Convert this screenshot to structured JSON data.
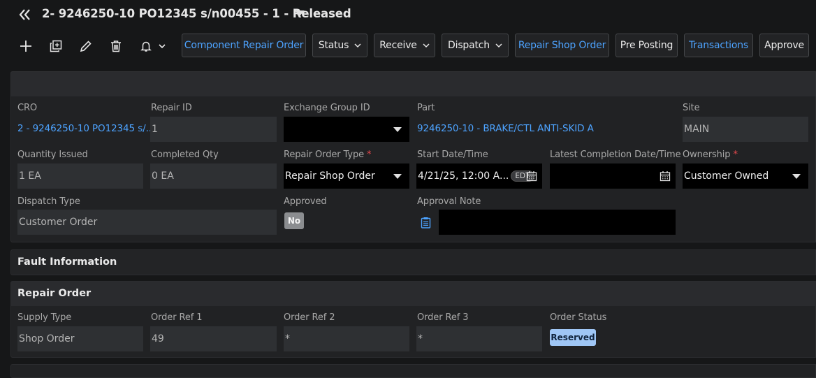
{
  "header": {
    "title": "2- 9246250-10 PO12345 s/n00455 - 1 - Released"
  },
  "toolbar": {
    "icons": [
      "add-icon",
      "duplicate-icon",
      "edit-icon",
      "delete-icon",
      "bell-icon"
    ],
    "buttons": {
      "component_repair_order": "Component Repair Order",
      "status": "Status",
      "receive": "Receive",
      "dispatch": "Dispatch",
      "repair_shop_order": "Repair Shop Order",
      "pre_posting": "Pre Posting",
      "transactions": "Transactions",
      "approve": "Approve"
    }
  },
  "header_panel": {
    "cro_label": "CRO",
    "cro_value": "2 - 9246250-10 PO12345 s/...",
    "repair_id_label": "Repair ID",
    "repair_id_value": "1",
    "exchange_group_id_label": "Exchange Group ID",
    "exchange_group_id_value": "",
    "part_label": "Part",
    "part_value": "9246250-10 - BRAKE/CTL ANTI-SKID A",
    "site_label": "Site",
    "site_value": "MAIN",
    "quantity_issued_label": "Quantity Issued",
    "quantity_issued_value": "1 EA",
    "completed_qty_label": "Completed Qty",
    "completed_qty_value": "0 EA",
    "repair_order_type_label": "Repair Order Type",
    "repair_order_type_value": "Repair Shop Order",
    "start_datetime_label": "Start Date/Time",
    "start_datetime_value": "4/21/25, 12:00 A...",
    "start_tz": "EDT",
    "latest_completion_label": "Latest Completion Date/Time",
    "latest_completion_value": "",
    "ownership_label": "Ownership",
    "ownership_value": "Customer Owned",
    "required_marker": "*",
    "dispatch_type_label": "Dispatch Type",
    "dispatch_type_value": "Customer Order",
    "approved_label": "Approved",
    "approved_value": "No",
    "approval_note_label": "Approval Note",
    "approval_note_value": ""
  },
  "fault_section": {
    "title": "Fault Information"
  },
  "repair_order_section": {
    "title": "Repair Order",
    "supply_type_label": "Supply Type",
    "supply_type_value": "Shop Order",
    "order_ref1_label": "Order Ref 1",
    "order_ref1_value": "49",
    "order_ref2_label": "Order Ref 2",
    "order_ref2_value": "*",
    "order_ref3_label": "Order Ref 3",
    "order_ref3_value": "*",
    "order_status_label": "Order Status",
    "order_status_value": "Reserved"
  },
  "colors": {
    "background": "#161718",
    "panel": "#212224",
    "link": "#4da3ff",
    "required": "#e5484d",
    "status_badge": "#9fc6f5"
  }
}
